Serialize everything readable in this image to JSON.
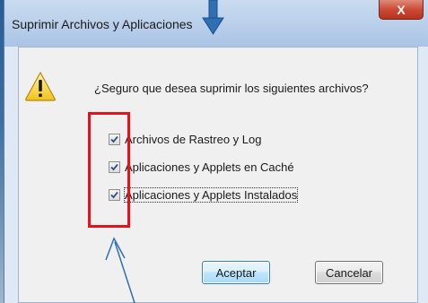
{
  "window": {
    "title": "Suprimir Archivos y Aplicaciones",
    "close_label": "X"
  },
  "dialog": {
    "icon": "warning-icon",
    "question": "¿Seguro que desea suprimir los siguientes archivos?",
    "options": [
      {
        "label": "Archivos de Rastreo y Log",
        "checked": true
      },
      {
        "label": "Aplicaciones y Applets en Caché",
        "checked": true
      },
      {
        "label": "Aplicaciones y Applets Instalados",
        "checked": true
      }
    ],
    "ok_label": "Aceptar",
    "cancel_label": "Cancelar"
  },
  "annotations": {
    "highlight_color": "#e8101a",
    "arrow_color": "#2f6fb3"
  }
}
